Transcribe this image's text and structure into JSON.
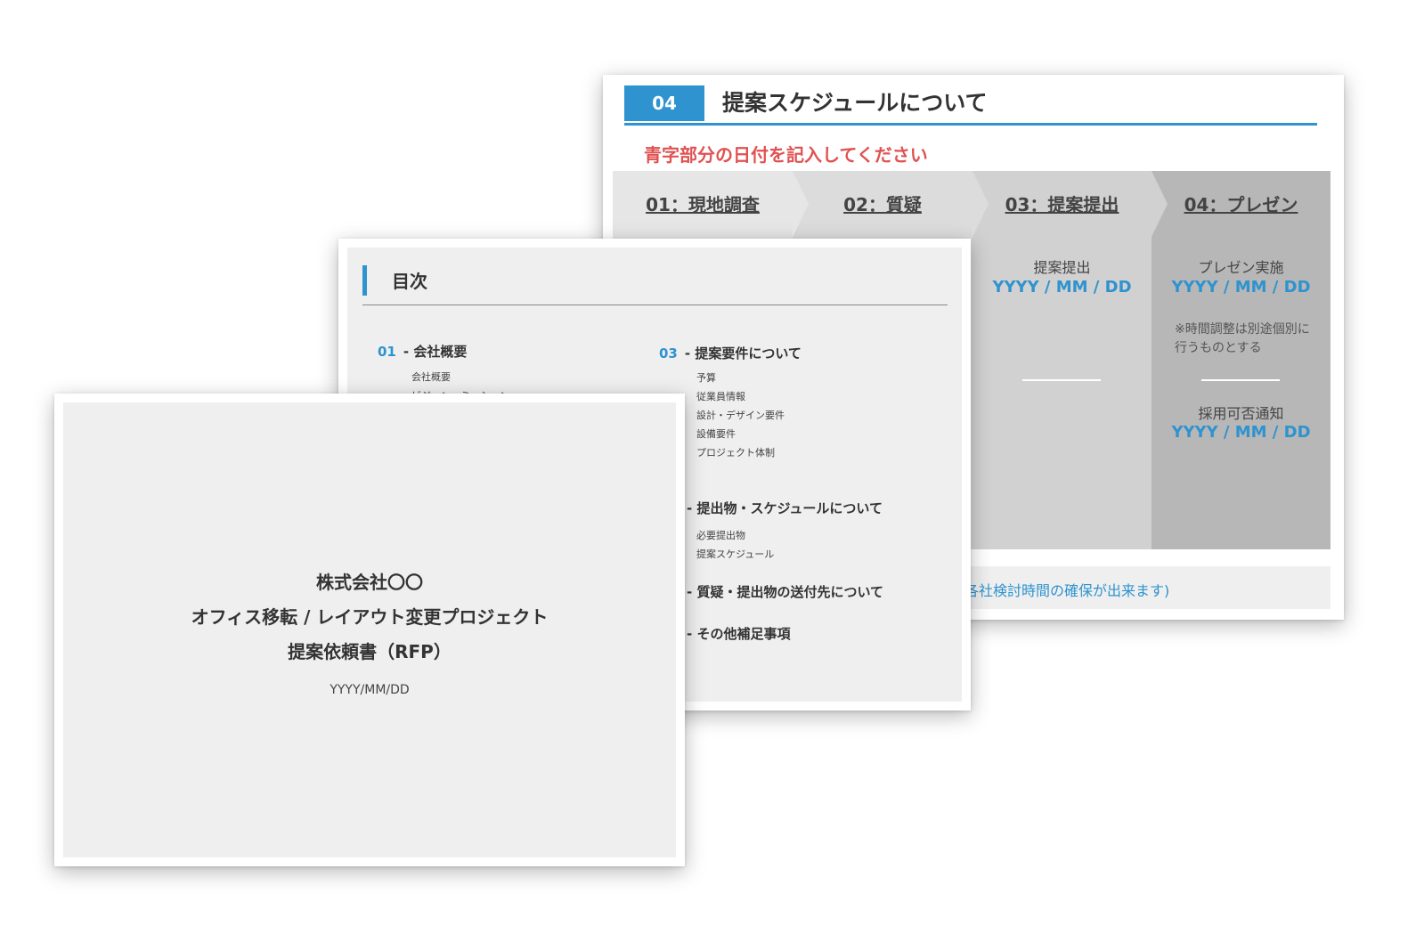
{
  "schedule_slide": {
    "number": "04",
    "title": "提案スケジュールについて",
    "note": "青字部分の日付を記入してください",
    "steps": [
      {
        "label": "01：現地調査"
      },
      {
        "label": "02：質疑"
      },
      {
        "label": "03：提案提出",
        "item": "提案提出",
        "date": "YYYY / MM / DD"
      },
      {
        "label": "04：プレゼン",
        "item": "プレゼン実施",
        "date": "YYYY / MM / DD",
        "note": "※時間調整は別途個別に行うものとする",
        "item2": "採用可否通知",
        "date2": "YYYY / MM / DD"
      }
    ],
    "footer_text": "各社検討時間の確保が出来ます)"
  },
  "toc_slide": {
    "title": "目次",
    "sections": [
      {
        "number": "01",
        "title": "- 会社概要",
        "items": [
          "会社概要",
          "ビジョン・ミッション"
        ]
      },
      {
        "number": "03",
        "title": "- 提案要件について",
        "items": [
          "予算",
          "従業員情報",
          "設計・デザイン要件",
          "設備要件",
          "プロジェクト体制"
        ]
      },
      {
        "title": "- 提出物・スケジュールについて",
        "items": [
          "必要提出物",
          "提案スケジュール"
        ]
      },
      {
        "title": "- 質疑・提出物の送付先について"
      },
      {
        "title": "- その他補足事項"
      }
    ]
  },
  "cover_slide": {
    "company": "株式会社〇〇",
    "project": "オフィス移転 / レイアウト変更プロジェクト",
    "doc_title": "提案依頼書（RFP）",
    "date": "YYYY/MM/DD"
  },
  "colors": {
    "accent": "#2e93cf",
    "note_red": "#e05252",
    "slide_bg": "#efefef"
  }
}
